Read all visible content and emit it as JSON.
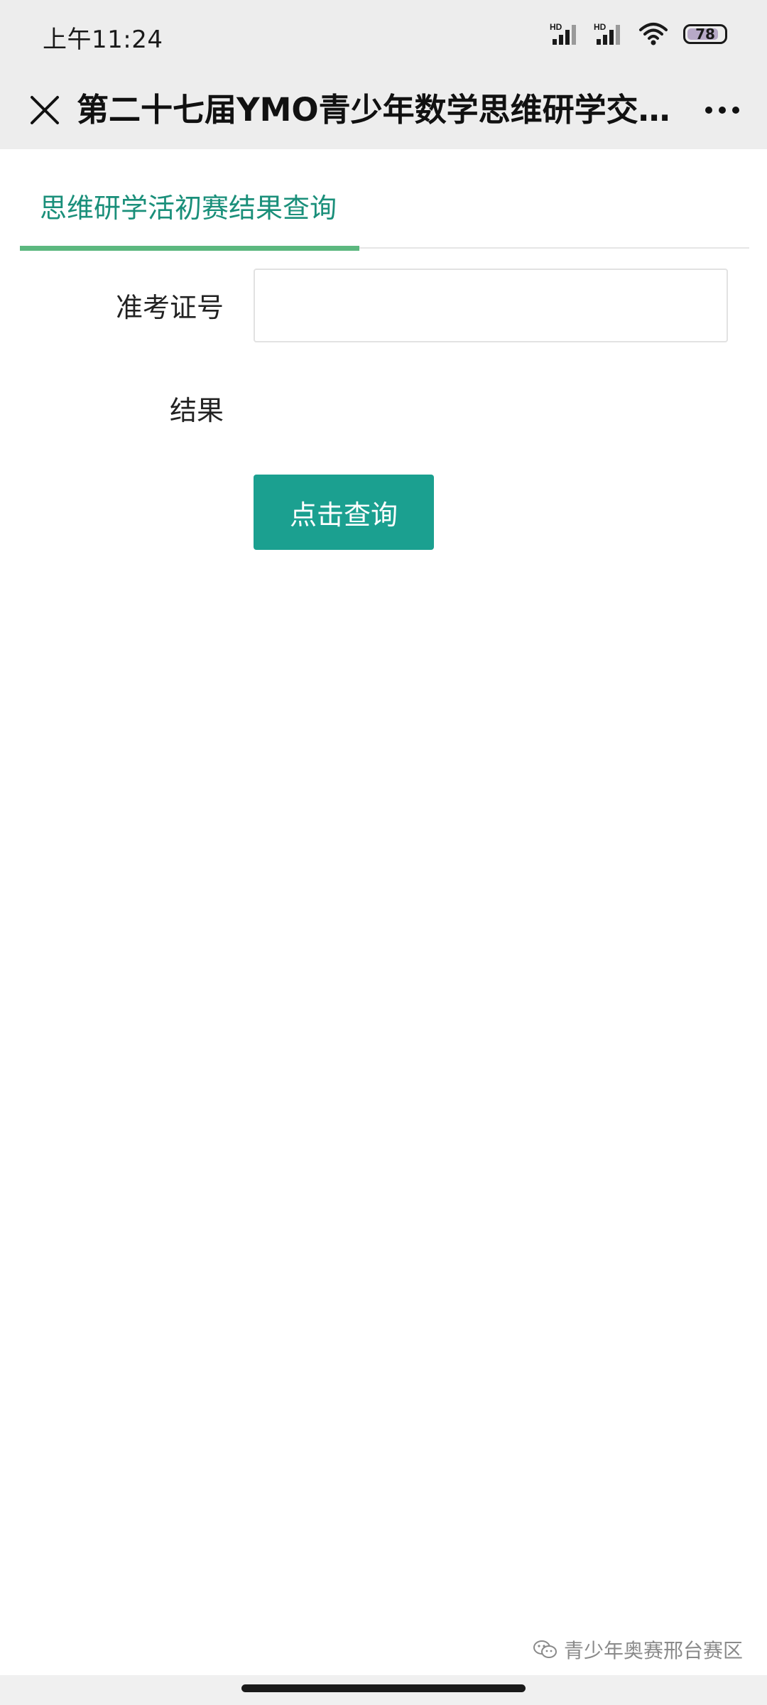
{
  "status_bar": {
    "time": "上午11:24",
    "battery": "78",
    "signal1_label": "HD",
    "signal2_label": "HD"
  },
  "header": {
    "title": "第二十七届YMO青少年数学思维研学交流活动",
    "close_icon": "close-icon",
    "more_icon": "more-icon"
  },
  "tabs": [
    {
      "label": "思维研学活初赛结果查询",
      "active": true
    }
  ],
  "form": {
    "ticket_label": "准考证号",
    "ticket_value": "",
    "ticket_placeholder": "",
    "result_label": "结果",
    "result_value": "",
    "submit_label": "点击查询"
  },
  "footer": {
    "watermark": "青少年奥赛邢台赛区"
  },
  "colors": {
    "accent": "#1ba090",
    "tab_text": "#1a8f7a",
    "tab_indicator": "#5cb87f",
    "chrome_bg": "#ededed"
  }
}
